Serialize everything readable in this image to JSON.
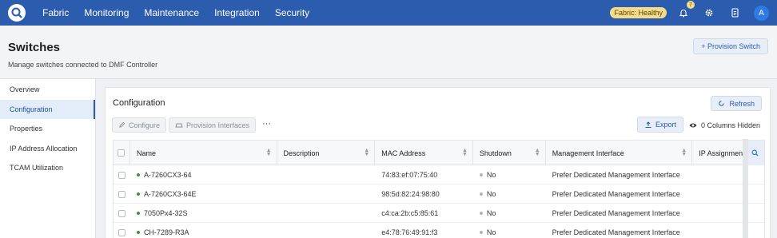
{
  "nav": {
    "items": [
      "Fabric",
      "Monitoring",
      "Maintenance",
      "Integration",
      "Security"
    ],
    "health_badge": "Fabric: Healthy",
    "notification_count": "7",
    "avatar_initial": "A"
  },
  "header": {
    "title": "Switches",
    "subtitle": "Manage switches connected to DMF Controller",
    "provision_switch_label": "+ Provision Switch"
  },
  "sidebar": {
    "items": [
      {
        "label": "Overview",
        "active": false
      },
      {
        "label": "Configuration",
        "active": true
      },
      {
        "label": "Properties",
        "active": false
      },
      {
        "label": "IP Address Allocation",
        "active": false
      },
      {
        "label": "TCAM Utilization",
        "active": false
      }
    ]
  },
  "panel": {
    "title": "Configuration",
    "refresh_label": "Refresh",
    "configure_label": "Configure",
    "provision_interfaces_label": "Provision Interfaces",
    "more_label": "···",
    "export_label": "Export",
    "columns_hidden_label": "0 Columns Hidden"
  },
  "table": {
    "columns": [
      "Name",
      "Description",
      "MAC Address",
      "Shutdown",
      "Management Interface",
      "IP Assignment"
    ],
    "rows": [
      {
        "name": "A-7260CX3-64",
        "description": "",
        "mac": "74:83:ef:07:75:40",
        "shutdown": "No",
        "mgmt": "Prefer Dedicated Management Interface"
      },
      {
        "name": "A-7260CX3-64E",
        "description": "",
        "mac": "98:5d:82:24:98:80",
        "shutdown": "No",
        "mgmt": "Prefer Dedicated Management Interface"
      },
      {
        "name": "7050Px4-32S",
        "description": "",
        "mac": "c4:ca:2b:c5:85:61",
        "shutdown": "No",
        "mgmt": "Prefer Dedicated Management Interface"
      },
      {
        "name": "CH-7289-R3A",
        "description": "",
        "mac": "e4:78:76:49:91:f3",
        "shutdown": "No",
        "mgmt": "Prefer Dedicated Management Interface"
      }
    ]
  },
  "colors": {
    "brand": "#2b5cae",
    "status_up": "#2a9d3a",
    "health_badge": "#f5dc8c"
  }
}
